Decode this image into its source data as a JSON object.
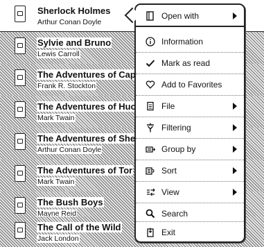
{
  "books": [
    {
      "title": "Sherlock Holmes",
      "author": "Arthur Conan Doyle"
    },
    {
      "title": "Sylvie and Bruno",
      "author": "Lewis Carroll"
    },
    {
      "title": "The Adventures of Cap",
      "author": "Frank R. Stockton"
    },
    {
      "title": "The Adventures of Huc",
      "author": "Mark Twain"
    },
    {
      "title": "The Adventures of She",
      "author": "Arthur Conan Doyle"
    },
    {
      "title": "The Adventures of Tor",
      "author": "Mark Twain"
    },
    {
      "title": "The Bush Boys",
      "author": "Mayne Reid"
    },
    {
      "title": "The Call of the Wild",
      "author": "Jack London"
    }
  ],
  "menu": {
    "items": [
      {
        "label": "Open with",
        "icon": "open-with-icon",
        "submenu": true
      },
      {
        "label": "Information",
        "icon": "info-icon",
        "submenu": false
      },
      {
        "label": "Mark as read",
        "icon": "checkmark-icon",
        "submenu": false
      },
      {
        "label": "Add to Favorites",
        "icon": "heart-icon",
        "submenu": false
      },
      {
        "label": "File",
        "icon": "file-icon",
        "submenu": true
      },
      {
        "label": "Filtering",
        "icon": "filter-icon",
        "submenu": true
      },
      {
        "label": "Group by",
        "icon": "group-icon",
        "submenu": true
      },
      {
        "label": "Sort",
        "icon": "sort-icon",
        "submenu": true
      },
      {
        "label": "View",
        "icon": "view-icon",
        "submenu": true
      },
      {
        "label": "Search",
        "icon": "search-icon",
        "submenu": false
      },
      {
        "label": "Exit",
        "icon": "exit-icon",
        "submenu": false
      }
    ]
  }
}
